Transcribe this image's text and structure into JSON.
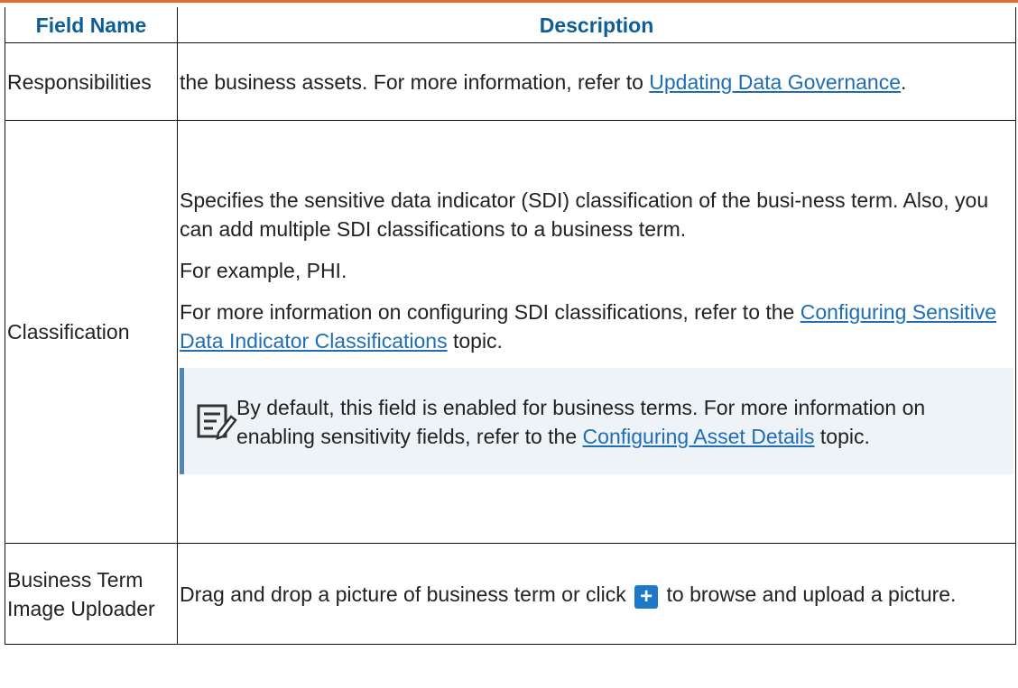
{
  "table": {
    "headers": [
      "Field Name",
      "Description"
    ],
    "rows": [
      {
        "field": "Responsibilities",
        "text_before": "the business assets. For more information, refer to ",
        "link": "Updating Data Governance",
        "text_after": "."
      },
      {
        "field": "Classification",
        "para1": "Specifies the sensitive data indicator (SDI) classification of the busi-ness term. Also, you can add multiple SDI classifications to a business term.",
        "para2": "For example, PHI.",
        "para3_before": "For more information on configuring SDI classifications, refer to the ",
        "para3_link": "Configuring Sensitive Data Indicator Classifications",
        "para3_after": " topic.",
        "note": {
          "icon": "note-edit-icon",
          "before": "By default, this field is enabled for business terms. For more information on enabling sensitivity fields, refer to the ",
          "link": "Configuring Asset Details",
          "after": " topic."
        }
      },
      {
        "field": "Business Term Image Uploader",
        "before": "Drag and drop a picture of business term or click ",
        "button_icon": "plus-icon",
        "button_glyph": "+",
        "after": " to browse and upload a picture."
      }
    ]
  },
  "colors": {
    "accent": "#e96a2c",
    "header_text": "#0e5d97",
    "link": "#1f6db6",
    "note_bg": "#eef3f7",
    "note_bar": "#4f86b8",
    "button": "#1c78c9"
  }
}
